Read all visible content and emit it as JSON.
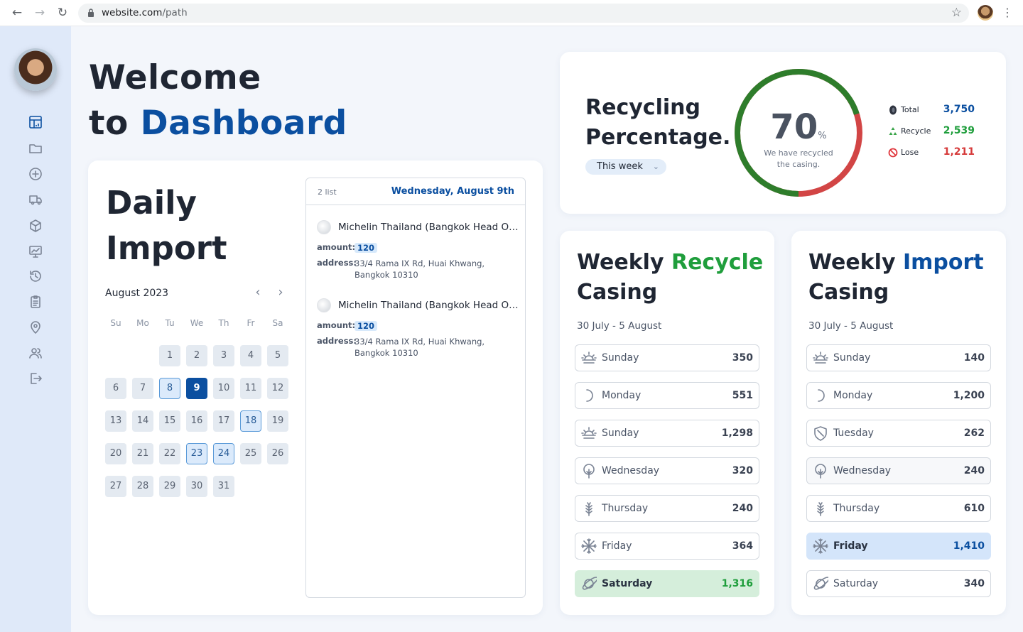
{
  "browser": {
    "url_domain": "website.com",
    "url_path": "/path"
  },
  "welcome": {
    "line1": "Welcome",
    "line2_prefix": "to",
    "line2_accent": "Dashboard"
  },
  "sidebar": {
    "items": [
      {
        "icon": "dashboard-icon"
      },
      {
        "icon": "folder-icon"
      },
      {
        "icon": "plus-circle-icon"
      },
      {
        "icon": "truck-icon"
      },
      {
        "icon": "box-icon"
      },
      {
        "icon": "monitor-chart-icon"
      },
      {
        "icon": "history-icon"
      },
      {
        "icon": "clipboard-icon"
      },
      {
        "icon": "location-icon"
      },
      {
        "icon": "users-icon"
      },
      {
        "icon": "logout-icon"
      }
    ]
  },
  "daily_import": {
    "title_line1": "Daily",
    "title_line2": "Import",
    "month": "August 2023",
    "weekdays": [
      "Su",
      "Mo",
      "Tu",
      "We",
      "Th",
      "Fr",
      "Sa"
    ],
    "first_weekday_index": 2,
    "days_in_month": 31,
    "selected_day": 9,
    "marked_days": [
      8,
      18,
      23,
      24
    ],
    "list": {
      "count": "2 list",
      "date": "Wednesday, August 9th",
      "entries": [
        {
          "name": "Michelin Thailand (Bangkok Head Offi...",
          "amount_label": "amount:",
          "amount": "120",
          "address_label": "address:",
          "address": "33/4 Rama IX Rd, Huai Khwang, Bangkok 10310"
        },
        {
          "name": "Michelin Thailand (Bangkok Head Offi...",
          "amount_label": "amount:",
          "amount": "120",
          "address_label": "address:",
          "address": "33/4 Rama IX Rd, Huai Khwang, Bangkok 10310"
        }
      ]
    }
  },
  "recycling": {
    "title_line1": "Recycling",
    "title_line2": "Percentage.",
    "period": "This week",
    "percent": "70",
    "percent_value": 70,
    "percent_sign": "%",
    "subtitle": "We have recycled the casing.",
    "colors": {
      "recycled": "#2e7d2b",
      "lost": "#d24545"
    },
    "legend": [
      {
        "icon": "tire-icon",
        "label": "Total",
        "value": "3,750",
        "color": "#0b4fa0"
      },
      {
        "icon": "recycle-icon",
        "label": "Recycle",
        "value": "2,539",
        "color": "#1f9e3c"
      },
      {
        "icon": "ban-icon",
        "label": "Lose",
        "value": "1,211",
        "color": "#d63a3a"
      }
    ]
  },
  "weekly_recycle": {
    "title_word1": "Weekly",
    "title_accent": "Recycle",
    "title_line2": "Casing",
    "range": "30 July - 5 August",
    "rows": [
      {
        "icon": "sunrise-icon",
        "day": "Sunday",
        "value": "350"
      },
      {
        "icon": "moon-icon",
        "day": "Monday",
        "value": "551"
      },
      {
        "icon": "sunrise-icon",
        "day": "Sunday",
        "value": "1,298"
      },
      {
        "icon": "tree-icon",
        "day": "Wednesday",
        "value": "320"
      },
      {
        "icon": "wheat-icon",
        "day": "Thursday",
        "value": "240"
      },
      {
        "icon": "snowflake-icon",
        "day": "Friday",
        "value": "364"
      },
      {
        "icon": "planet-icon",
        "day": "Saturday",
        "value": "1,316",
        "highlight": "green"
      }
    ]
  },
  "weekly_import": {
    "title_word1": "Weekly",
    "title_accent": "Import",
    "title_line2": "Casing",
    "range": "30 July - 5 August",
    "rows": [
      {
        "icon": "sunrise-icon",
        "day": "Sunday",
        "value": "140"
      },
      {
        "icon": "moon-icon",
        "day": "Monday",
        "value": "1,200"
      },
      {
        "icon": "shield-icon",
        "day": "Tuesday",
        "value": "262"
      },
      {
        "icon": "tree-icon",
        "day": "Wednesday",
        "value": "240",
        "highlight": "grey"
      },
      {
        "icon": "wheat-icon",
        "day": "Thursday",
        "value": "610"
      },
      {
        "icon": "snowflake-icon",
        "day": "Friday",
        "value": "1,410",
        "highlight": "blue"
      },
      {
        "icon": "planet-icon",
        "day": "Saturday",
        "value": "340"
      }
    ]
  }
}
